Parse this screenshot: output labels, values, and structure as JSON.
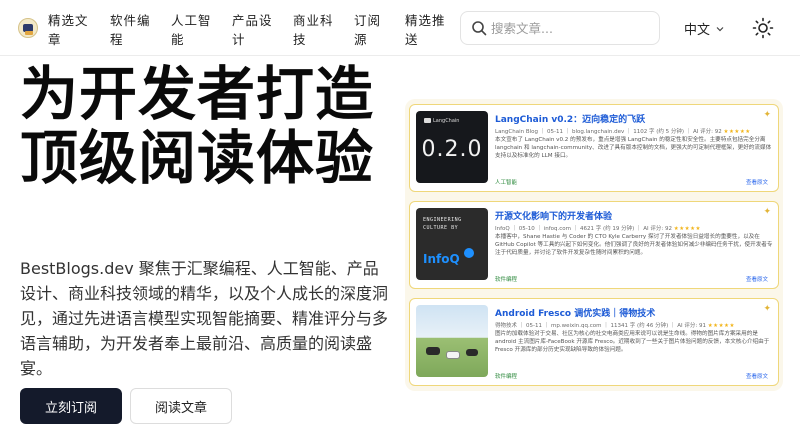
{
  "header": {
    "logo_icon": "bestblogs-logo-icon",
    "nav": [
      "精选文章",
      "软件编程",
      "人工智能",
      "产品设计",
      "商业科技",
      "订阅源",
      "精选推送"
    ],
    "search_placeholder": "搜索文章...",
    "language": "中文",
    "theme_icon": "sun-icon"
  },
  "hero": {
    "title": "为开发者打造顶级阅读体验",
    "description": "BestBlogs.dev 聚焦于汇聚编程、人工智能、产品设计、商业科技领域的精华，以及个人成长的深度洞见，通过先进语言模型实现智能摘要、精准评分与多语言辅助，为开发者奉上最前沿、高质量的阅读盛宴。",
    "subscribe_button": "立刻订阅",
    "read_button": "阅读文章"
  },
  "cards": [
    {
      "title": "LangChain v0.2：迈向稳定的飞跃",
      "meta": "LangChain Blog ｜ 05-11 ｜ blog.langchain.dev ｜ 1102 字 (约 5 分钟) ｜ AI 评分: 92",
      "stars": "★★★★★",
      "description": "本文宣布了 LangChain v0.2 的预发布，重点是增强 LangChain 的稳定性和安全性。主要特点包括完全分离 langchain 和 langchain-community、改进了具有版本控制的文档，更强大的可定制代理框架，更好的流媒体支持以及标准化的 LLM 接口。",
      "tag": "人工智能",
      "link": "查看原文",
      "thumb_brand": "LangChain",
      "thumb_text": "0.2.0"
    },
    {
      "title": "开源文化影响下的开发者体验",
      "meta": "InfoQ ｜ 05-10 ｜ infoq.com ｜ 4621 字 (约 19 分钟) ｜ AI 评分: 92",
      "stars": "★★★★★",
      "description": "本播客中，Shane Hastie 与 Coder 的 CTO Kyle Carberry 探讨了开发者体验日益增长的重要性，以及在 GitHub Copilot 等工具的兴起下如何变化。他们强调了良好的开发者体验如何减少非编码任务干扰，使开发者专注于代码质量，并讨论了软件开发复杂性随时间累积的问题。",
      "tag": "软件编程",
      "link": "查看原文",
      "thumb_text": "ENGINEERING CULTURE BY",
      "thumb_brand": "InfoQ"
    },
    {
      "title": "Android Fresco 调优实践｜得物技术",
      "meta": "得物技术 ｜ 05-11 ｜ mp.weixin.qq.com ｜ 11341 字 (约 46 分钟) ｜ AI 评分: 91",
      "stars": "★★★★★",
      "description": "图片的加载体验对于交易、社区为核心的社交电商类应用来说可以说是生命线。得物的图片库方案采用的是 android 主流图片库-FaceBook 开源库 Fresco。近期收到了一些关于图片体验问题的反馈，本文核心介绍由于 Fresco 开源库的部分历史实现缺陷导致的体验问题。",
      "tag": "软件编程",
      "link": "查看原文"
    }
  ]
}
